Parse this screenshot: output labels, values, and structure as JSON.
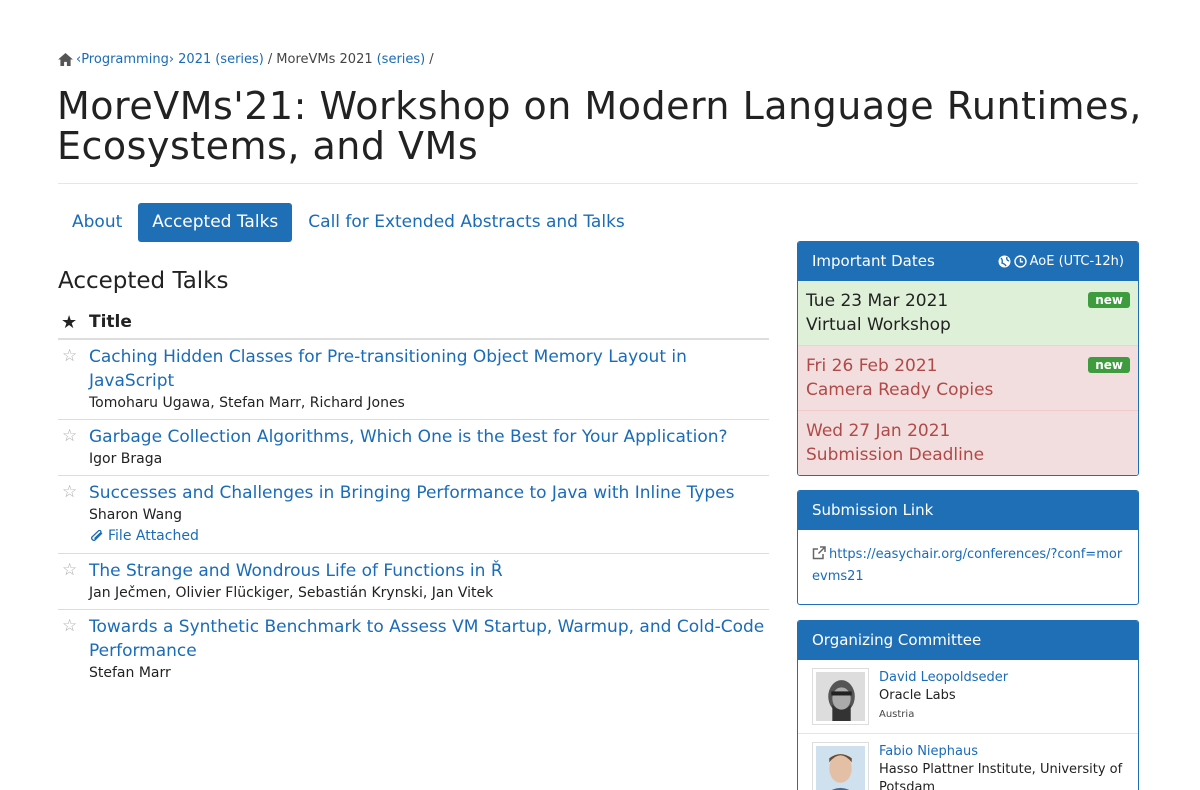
{
  "breadcrumb": {
    "programming": "‹Programming› 2021",
    "series1": "(series)",
    "sep1": "/",
    "conf": "MoreVMs 2021",
    "series2": "(series)",
    "sep2": "/"
  },
  "page_title": "MoreVMs'21: Workshop on Modern Language Runtimes, Ecosystems, and VMs",
  "tabs": [
    {
      "label": "About"
    },
    {
      "label": "Accepted Talks"
    },
    {
      "label": "Call for Extended Abstracts and Talks"
    }
  ],
  "section_heading": "Accepted Talks",
  "table": {
    "header": "Title",
    "rows": [
      {
        "title": "Caching Hidden Classes for Pre-transitioning Object Memory Layout in JavaScript",
        "authors": "Tomoharu Ugawa, Stefan Marr, Richard Jones"
      },
      {
        "title": "Garbage Collection Algorithms, Which One is the Best for Your Application?",
        "authors": "Igor Braga"
      },
      {
        "title": "Successes and Challenges in Bringing Performance to Java with Inline Types",
        "authors": "Sharon Wang",
        "file": "File Attached"
      },
      {
        "title": "The Strange and Wondrous Life of Functions in Ř",
        "authors": "Jan Ječmen, Olivier Flückiger, Sebastián Krynski, Jan Vitek"
      },
      {
        "title": "Towards a Synthetic Benchmark to Assess VM Startup, Warmup, and Cold-Code Performance",
        "authors": "Stefan Marr"
      }
    ]
  },
  "important_dates": {
    "header": "Important Dates",
    "timezone": "AoE (UTC-12h)",
    "items": [
      {
        "date": "Tue 23 Mar 2021",
        "event": "Virtual Workshop",
        "badge": "new"
      },
      {
        "date": "Fri 26 Feb 2021",
        "event": "Camera Ready Copies",
        "badge": "new"
      },
      {
        "date": "Wed 27 Jan 2021",
        "event": "Submission Deadline"
      }
    ]
  },
  "submission": {
    "header": "Submission Link",
    "url": "https://easychair.org/conferences/?conf=morevms21"
  },
  "committee": {
    "header": "Organizing Committee",
    "members": [
      {
        "name": "David Leopoldseder",
        "org": "Oracle Labs",
        "country": "Austria"
      },
      {
        "name": "Fabio Niephaus",
        "org": "Hasso Plattner Institute, University of Potsdam"
      }
    ]
  },
  "colors": {
    "accent": "#1f6fb7",
    "link": "#1a6bb8",
    "new_badge": "#3e9b3e",
    "upcoming_bg": "#dff0d8",
    "past_bg": "#f2dede",
    "past_text": "#b04a48"
  }
}
